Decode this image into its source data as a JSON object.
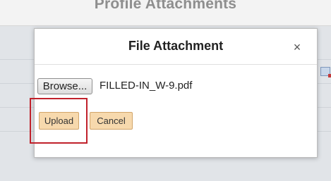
{
  "background": {
    "page_title": "Profile Attachments"
  },
  "dialog": {
    "title": "File Attachment",
    "close_label": "×",
    "file_input": {
      "browse_label": "Browse...",
      "selected_file": "FILLED-IN_W-9.pdf"
    },
    "actions": {
      "upload_label": "Upload",
      "cancel_label": "Cancel"
    }
  },
  "colors": {
    "button_fill": "#f7d9ad",
    "highlight_border": "#c0212b"
  }
}
